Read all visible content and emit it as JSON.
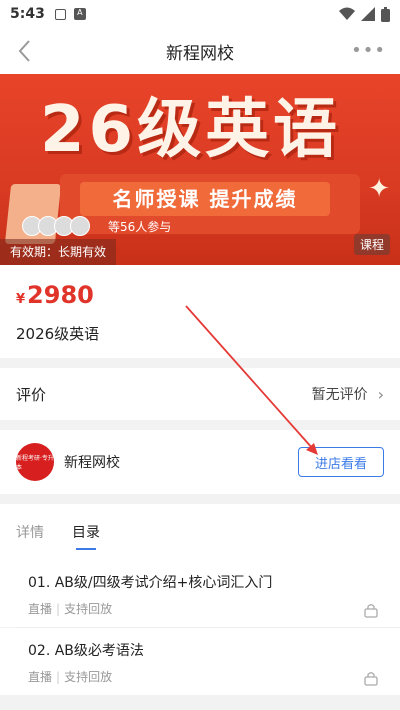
{
  "status_bar": {
    "time": "5:43",
    "a_badge": "A"
  },
  "nav": {
    "title": "新程网校"
  },
  "banner": {
    "headline": "26级英语",
    "slogan": "名师授课  提升成绩",
    "participants": "等56人参与",
    "validity": "有效期：长期有效",
    "tag": "课程"
  },
  "product": {
    "currency": "¥",
    "price": "2980",
    "name": "2026级英语"
  },
  "rating": {
    "label": "评价",
    "status": "暂无评价"
  },
  "shop": {
    "name": "新程网校",
    "logo_text": "新程考研·专升本",
    "enter_label": "进店看看"
  },
  "tabs": [
    {
      "label": "详情"
    },
    {
      "label": "目录"
    }
  ],
  "lessons": [
    {
      "title": "01. AB级/四级考试介绍+核心词汇入门",
      "type": "直播",
      "replay": "支持回放"
    },
    {
      "title": "02. AB级必考语法",
      "type": "直播",
      "replay": "支持回放"
    }
  ],
  "colors": {
    "accent": "#3b7be8",
    "price": "#e0342a",
    "banner": "#e8442a",
    "arrow": "#e53935"
  }
}
